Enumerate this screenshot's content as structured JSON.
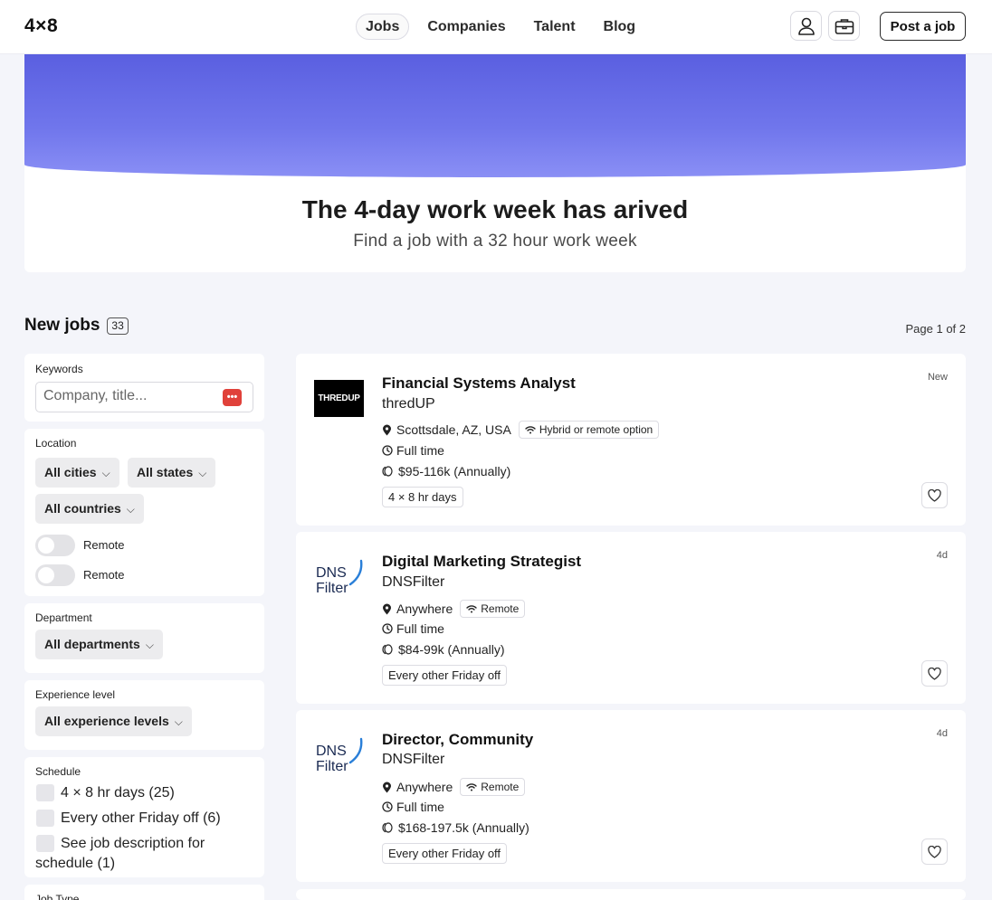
{
  "header": {
    "logo": "4×8",
    "nav": [
      {
        "label": "Jobs",
        "active": true
      },
      {
        "label": "Companies",
        "active": false
      },
      {
        "label": "Talent",
        "active": false
      },
      {
        "label": "Blog",
        "active": false
      }
    ],
    "icons": [
      "user-icon",
      "briefcase-icon"
    ],
    "post_job": "Post a job"
  },
  "hero": {
    "title": "The 4-day work week has arived",
    "subtitle": "Find a job with a 32 hour work week",
    "accent": "#6468e8"
  },
  "listing": {
    "heading": "New jobs",
    "count": "33",
    "page_info": "Page 1 of 2"
  },
  "filters": {
    "keywords": {
      "label": "Keywords",
      "placeholder": "Company, title..."
    },
    "location": {
      "label": "Location",
      "cities": "All cities",
      "states": "All states",
      "countries": "All countries",
      "toggles": [
        "Remote",
        "Remote"
      ]
    },
    "department": {
      "label": "Department",
      "value": "All departments"
    },
    "experience": {
      "label": "Experience level",
      "value": "All experience levels"
    },
    "schedule": {
      "label": "Schedule",
      "options": [
        "4 × 8 hr days (25)",
        "Every other Friday off (6)",
        "See job description for schedule (1)"
      ]
    },
    "job_type": {
      "label": "Job Type"
    }
  },
  "jobs": [
    {
      "title": "Financial Systems Analyst",
      "company": "thredUP",
      "logo_text": "THREDUP",
      "location": "Scottsdale, AZ, USA",
      "remote": "Hybrid or remote option",
      "type": "Full time",
      "salary": "$95-116k (Annually)",
      "schedule": "4 × 8 hr days",
      "date": "New"
    },
    {
      "title": "Digital Marketing Strategist",
      "company": "DNSFilter",
      "logo_text": "DNSFilter",
      "location": "Anywhere",
      "remote": "Remote",
      "type": "Full time",
      "salary": "$84-99k (Annually)",
      "schedule": "Every other Friday off",
      "date": "4d"
    },
    {
      "title": "Director, Community",
      "company": "DNSFilter",
      "logo_text": "DNSFilter",
      "location": "Anywhere",
      "remote": "Remote",
      "type": "Full time",
      "salary": "$168-197.5k (Annually)",
      "schedule": "Every other Friday off",
      "date": "4d"
    }
  ]
}
